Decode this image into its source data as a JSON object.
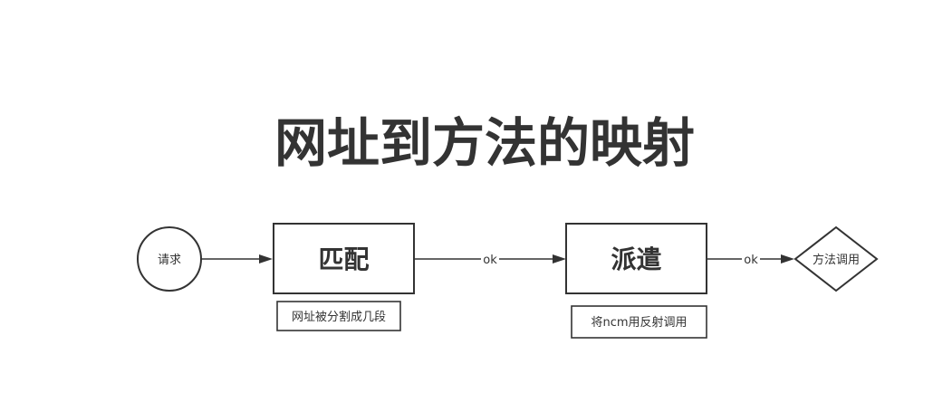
{
  "title": "网址到方法的映射",
  "nodes": {
    "request": {
      "label": "请求",
      "shape": "circle"
    },
    "match": {
      "label": "匹配",
      "shape": "rectangle"
    },
    "dispatch": {
      "label": "派遣",
      "shape": "rectangle"
    },
    "method_call": {
      "label": "方法调用",
      "shape": "diamond"
    }
  },
  "notes": {
    "match_note": "网址被分割成几段",
    "dispatch_note": "将ncm用反射调用"
  },
  "edges": [
    {
      "from": "request",
      "to": "match",
      "label": ""
    },
    {
      "from": "match",
      "to": "dispatch",
      "label": "ok"
    },
    {
      "from": "dispatch",
      "to": "method_call",
      "label": "ok"
    }
  ],
  "colors": {
    "stroke": "#333333",
    "text": "#333333",
    "background": "#ffffff"
  }
}
